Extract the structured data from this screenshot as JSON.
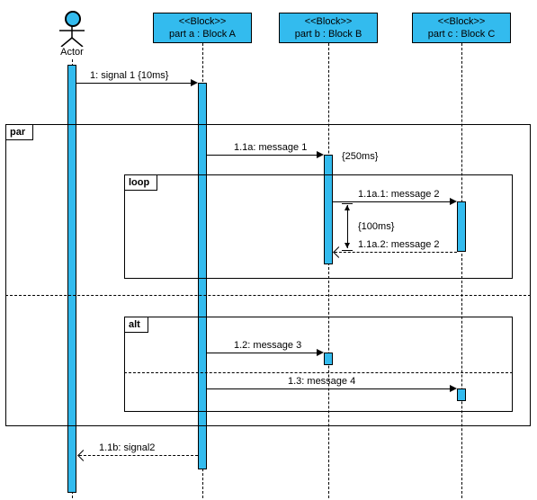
{
  "actor": {
    "label": "Actor"
  },
  "lifelines": {
    "a": {
      "stereotype": "<<Block>>",
      "label": "part a : Block A"
    },
    "b": {
      "stereotype": "<<Block>>",
      "label": "part b : Block B"
    },
    "c": {
      "stereotype": "<<Block>>",
      "label": "part c : Block C"
    }
  },
  "fragments": {
    "par": "par",
    "loop": "loop",
    "alt": "alt"
  },
  "messages": {
    "m1": "1: signal 1 {10ms}",
    "m11a": "1.1a: message 1",
    "m11a1": "1.1a.1: message 2",
    "m11a2": "1.1a.2: message 2",
    "m12": "1.2: message 3",
    "m13": "1.3: message 4",
    "m11b": "1.1b: signal2"
  },
  "constraints": {
    "c250": "{250ms}",
    "c100": "{100ms}"
  },
  "chart_data": {
    "type": "table",
    "diagram": "UML/SysML Sequence Diagram",
    "lifelines": [
      {
        "role": "Actor",
        "stereotype": null
      },
      {
        "role": "part a : Block A",
        "stereotype": "Block"
      },
      {
        "role": "part b : Block B",
        "stereotype": "Block"
      },
      {
        "role": "part c : Block C",
        "stereotype": "Block"
      }
    ],
    "messages": [
      {
        "seq": "1",
        "name": "signal 1",
        "from": "Actor",
        "to": "part a : Block A",
        "duration": "10ms",
        "fragment": null
      },
      {
        "seq": "1.1a",
        "name": "message 1",
        "from": "part a : Block A",
        "to": "part b : Block B",
        "duration": "250ms",
        "fragment": "par"
      },
      {
        "seq": "1.1a.1",
        "name": "message 2",
        "from": "part b : Block B",
        "to": "part c : Block C",
        "duration": null,
        "fragment": "par > loop"
      },
      {
        "seq": "1.1a.2",
        "name": "message 2",
        "from": "part c : Block C",
        "to": "part b : Block B",
        "duration": "100ms",
        "fragment": "par > loop",
        "return": true
      },
      {
        "seq": "1.2",
        "name": "message 3",
        "from": "part a : Block A",
        "to": "part b : Block B",
        "duration": null,
        "fragment": "par > alt (operand 1)"
      },
      {
        "seq": "1.3",
        "name": "message 4",
        "from": "part a : Block A",
        "to": "part c : Block C",
        "duration": null,
        "fragment": "par > alt (operand 2)"
      },
      {
        "seq": "1.1b",
        "name": "signal2",
        "from": "part a : Block A",
        "to": "Actor",
        "duration": null,
        "fragment": null,
        "return": true
      }
    ],
    "combined_fragments": [
      {
        "operator": "par",
        "operands": 2,
        "contains": [
          "1.1a",
          "loop",
          "alt",
          "1.2",
          "1.3"
        ]
      },
      {
        "operator": "loop",
        "operands": 1,
        "contains": [
          "1.1a.1",
          "1.1a.2"
        ]
      },
      {
        "operator": "alt",
        "operands": 2,
        "contains": [
          "1.2",
          "1.3"
        ]
      }
    ]
  }
}
